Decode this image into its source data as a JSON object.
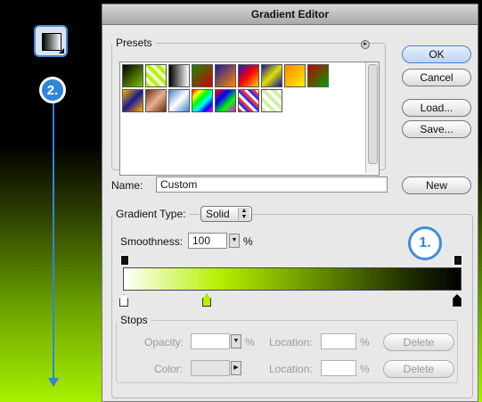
{
  "callouts": {
    "one": "1.",
    "two": "2."
  },
  "dialog": {
    "title": "Gradient Editor",
    "presets_label": "Presets",
    "buttons": {
      "ok": "OK",
      "cancel": "Cancel",
      "load": "Load...",
      "save": "Save...",
      "new": "New"
    },
    "name_label": "Name:",
    "name_value": "Custom",
    "gradient_type_label": "Gradient Type:",
    "gradient_type_value": "Solid",
    "smoothness_label": "Smoothness:",
    "smoothness_value": "100",
    "smoothness_unit": "%",
    "stops": {
      "legend": "Stops",
      "opacity_label": "Opacity:",
      "opacity_unit": "%",
      "location_label": "Location:",
      "location_unit": "%",
      "color_label": "Color:",
      "delete_label": "Delete"
    },
    "colors": {
      "accent": "#2e86d8",
      "ramp_start": "#ffffff",
      "ramp_mid": "#b7f000",
      "ramp_end": "#000000"
    }
  }
}
